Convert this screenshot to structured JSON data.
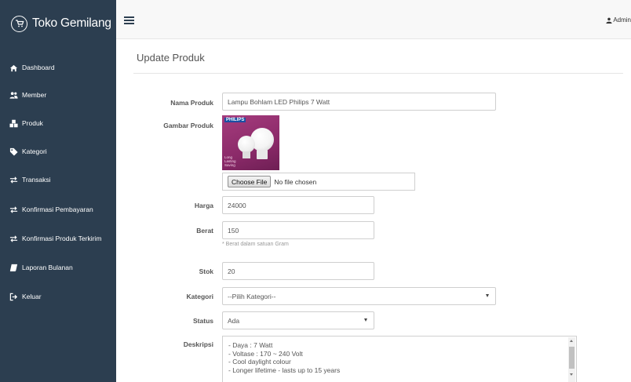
{
  "brand": {
    "title": "Toko Gemilang",
    "icon": "cart-icon"
  },
  "sidebar": {
    "items": [
      {
        "label": "Dashboard",
        "icon": "home-icon"
      },
      {
        "label": "Member",
        "icon": "users-icon"
      },
      {
        "label": "Produk",
        "icon": "cubes-icon"
      },
      {
        "label": "Kategori",
        "icon": "tag-icon"
      },
      {
        "label": "Transaksi",
        "icon": "exchange-icon"
      },
      {
        "label": "Konfirmasi Pembayaran",
        "icon": "exchange-icon"
      },
      {
        "label": "Konfirmasi Produk Terkirim",
        "icon": "exchange-icon"
      },
      {
        "label": "Laporan Bulanan",
        "icon": "book-icon"
      },
      {
        "label": "Keluar",
        "icon": "sign-out-icon"
      }
    ]
  },
  "topbar": {
    "user": "Admin",
    "user_icon": "user-icon",
    "menu_icon": "hamburger-icon"
  },
  "page": {
    "title": "Update Produk"
  },
  "form": {
    "nama_label": "Nama Produk",
    "nama_value": "Lampu Bohlam LED Philips 7 Watt",
    "gambar_label": "Gambar Produk",
    "image_brand": "PHILIPS",
    "image_text_1": "Long",
    "image_text_2": "Lasting",
    "image_text_3": "Saving",
    "file_button": "Choose File",
    "file_status": "No file chosen",
    "harga_label": "Harga",
    "harga_value": "24000",
    "berat_label": "Berat",
    "berat_value": "150",
    "berat_help": "* Berat dalam satuan Gram",
    "stok_label": "Stok",
    "stok_value": "20",
    "kategori_label": "Kategori",
    "kategori_value": "--Pilih Kategori--",
    "status_label": "Status",
    "status_value": "Ada",
    "deskripsi_label": "Deskripsi",
    "deskripsi_lines": [
      "- Daya : 7 Watt",
      "- Voltase : 170 ~ 240 Volt",
      "- Cool daylight colour",
      "- Longer lifetime - lasts up to 15 years"
    ]
  },
  "colors": {
    "sidebar": "#2c3e50",
    "topbar": "#f8f8f8",
    "image_bg": "#8b2a69"
  }
}
